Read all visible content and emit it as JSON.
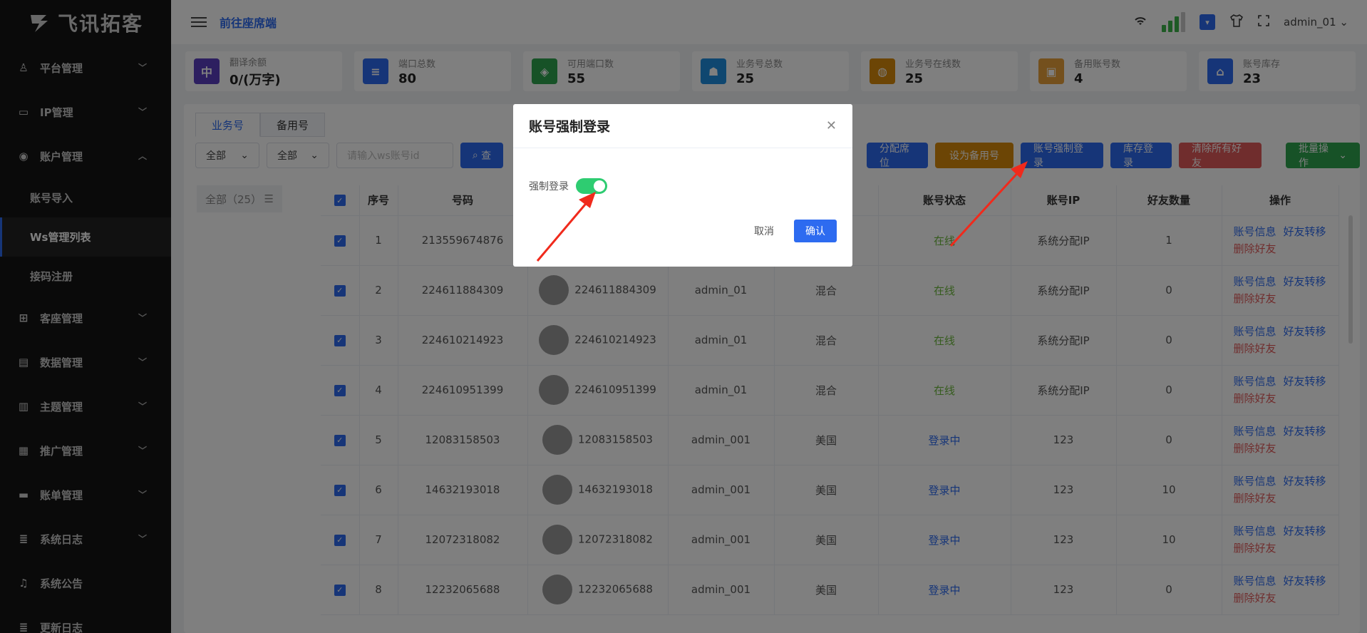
{
  "brand": {
    "name": "飞讯拓客"
  },
  "sidebar": {
    "items": [
      {
        "label": "平台管理",
        "icon": "user-icon"
      },
      {
        "label": "IP管理",
        "icon": "monitor-icon"
      },
      {
        "label": "账户管理",
        "icon": "globe-icon",
        "expanded": true
      },
      {
        "label": "客座管理",
        "icon": "cart-icon"
      },
      {
        "label": "数据管理",
        "icon": "archive-icon"
      },
      {
        "label": "主题管理",
        "icon": "book-icon"
      },
      {
        "label": "推广管理",
        "icon": "clipboard-icon"
      },
      {
        "label": "账单管理",
        "icon": "card-icon"
      },
      {
        "label": "系统日志",
        "icon": "log-icon"
      },
      {
        "label": "系统公告",
        "icon": "bell-icon"
      },
      {
        "label": "更新日志",
        "icon": "log-icon"
      }
    ],
    "sub_items": [
      {
        "label": "账号导入"
      },
      {
        "label": "Ws管理列表",
        "active": true
      },
      {
        "label": "接码注册"
      }
    ]
  },
  "topbar": {
    "link": "前往座席端",
    "user": "admin_01"
  },
  "stats": [
    {
      "label": "翻译余额",
      "value": "0/(万字)",
      "color": "#5a3fc0",
      "icon": "translate-icon"
    },
    {
      "label": "端口总数",
      "value": "80",
      "color": "#2d6bf0",
      "icon": "server-icon"
    },
    {
      "label": "可用端口数",
      "value": "55",
      "color": "#2ea44f",
      "icon": "layers-icon"
    },
    {
      "label": "业务号总数",
      "value": "25",
      "color": "#1e8fe0",
      "icon": "team-icon"
    },
    {
      "label": "业务号在线数",
      "value": "25",
      "color": "#d98a0a",
      "icon": "location-icon"
    },
    {
      "label": "备用账号数",
      "value": "4",
      "color": "#e8a13a",
      "icon": "box-icon"
    },
    {
      "label": "账号库存",
      "value": "23",
      "color": "#2d6bf0",
      "icon": "store-icon"
    }
  ],
  "tabs": [
    {
      "label": "业务号"
    },
    {
      "label": "备用号"
    }
  ],
  "filters": {
    "select1": "全部",
    "select2": "全部",
    "placeholder": "请输入ws账号id",
    "search": "查"
  },
  "actions": [
    {
      "label": "分配席位",
      "color": "#2d6bf0"
    },
    {
      "label": "设为备用号",
      "color": "#d98a0a"
    },
    {
      "label": "账号强制登录",
      "color": "#2d6bf0"
    },
    {
      "label": "库存登录",
      "color": "#2d6bf0"
    },
    {
      "label": "清除所有好友",
      "color": "#e05a5a"
    },
    {
      "label": "批量操作",
      "color": "#2ea44f"
    }
  ],
  "group": {
    "label": "全部（25）"
  },
  "table": {
    "headers": [
      "序号",
      "号码",
      "",
      "",
      "",
      "账号状态",
      "账号IP",
      "好友数量",
      "操作"
    ],
    "ops": {
      "info": "账号信息",
      "transfer": "好友转移",
      "delete": "删除好友"
    },
    "rows": [
      {
        "idx": "1",
        "phone": "213559674876",
        "avatar_num": "",
        "owner": "",
        "region": "",
        "status": "在线",
        "ip": "系统分配IP",
        "friends": "1"
      },
      {
        "idx": "2",
        "phone": "224611884309",
        "avatar_num": "224611884309",
        "owner": "admin_01",
        "region": "混合",
        "status": "在线",
        "ip": "系统分配IP",
        "friends": "0"
      },
      {
        "idx": "3",
        "phone": "224610214923",
        "avatar_num": "224610214923",
        "owner": "admin_01",
        "region": "混合",
        "status": "在线",
        "ip": "系统分配IP",
        "friends": "0"
      },
      {
        "idx": "4",
        "phone": "224610951399",
        "avatar_num": "224610951399",
        "owner": "admin_01",
        "region": "混合",
        "status": "在线",
        "ip": "系统分配IP",
        "friends": "0"
      },
      {
        "idx": "5",
        "phone": "12083158503",
        "avatar_num": "12083158503",
        "owner": "admin_001",
        "region": "美国",
        "status": "登录中",
        "ip": "123",
        "friends": "0"
      },
      {
        "idx": "6",
        "phone": "14632193018",
        "avatar_num": "14632193018",
        "owner": "admin_001",
        "region": "美国",
        "status": "登录中",
        "ip": "123",
        "friends": "10"
      },
      {
        "idx": "7",
        "phone": "12072318082",
        "avatar_num": "12072318082",
        "owner": "admin_001",
        "region": "美国",
        "status": "登录中",
        "ip": "123",
        "friends": "10"
      },
      {
        "idx": "8",
        "phone": "12232065688",
        "avatar_num": "12232065688",
        "owner": "admin_001",
        "region": "美国",
        "status": "登录中",
        "ip": "123",
        "friends": "0"
      }
    ]
  },
  "dialog": {
    "title": "账号强制登录",
    "switch_label": "强制登录",
    "switch_on": true,
    "cancel": "取消",
    "confirm": "确认"
  }
}
